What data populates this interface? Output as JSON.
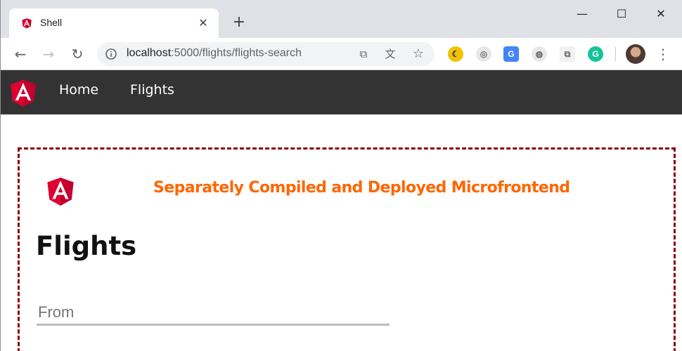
{
  "browser": {
    "tab": {
      "title": "Shell"
    },
    "address_bar": {
      "host": "localhost",
      "path": ":5000/flights/flights-search"
    }
  },
  "icons": {
    "back": "back-arrow-icon",
    "forward": "forward-arrow-icon",
    "reload": "reload-icon",
    "info": "info-icon",
    "open_external": "open-in-new-icon",
    "translate": "translate-icon",
    "bookmark": "star-icon",
    "menu": "kebab-menu-icon"
  },
  "app_nav": {
    "links": [
      {
        "label": "Home"
      },
      {
        "label": "Flights"
      }
    ]
  },
  "microfrontend": {
    "heading": "Separately Compiled and Deployed Microfrontend",
    "page_title": "Flights",
    "from_field": {
      "placeholder": "From",
      "value": ""
    }
  },
  "colors": {
    "nav_bg": "#333333",
    "mfe_border": "#8b0000",
    "heading": "#ff6600",
    "angular_red": "#dd0031"
  }
}
